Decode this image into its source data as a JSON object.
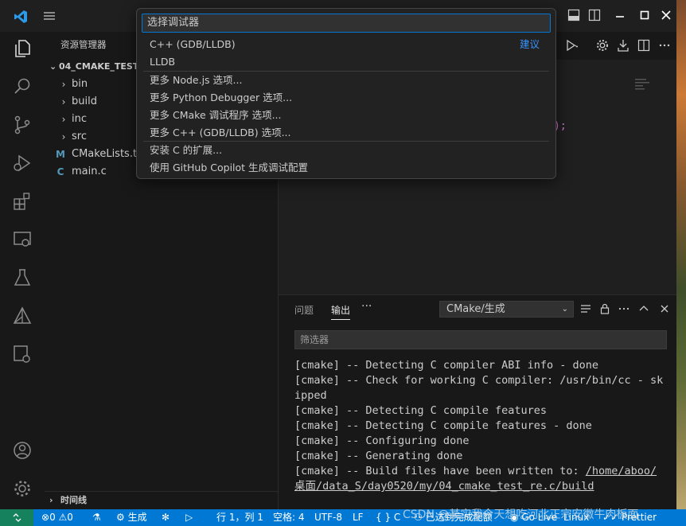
{
  "explorer": {
    "title": "资源管理器",
    "project": "04_CMAKE_TEST_",
    "items": [
      {
        "icon": "chevron-right",
        "label": "bin"
      },
      {
        "icon": "chevron-right",
        "label": "build"
      },
      {
        "icon": "chevron-right",
        "label": "inc"
      },
      {
        "icon": "chevron-right",
        "label": "src"
      },
      {
        "icon": "M",
        "label": "CMakeLists.txt"
      },
      {
        "icon": "C",
        "label": "main.c"
      }
    ],
    "timeline": "时间线"
  },
  "quickpick": {
    "placeholder": "选择调试器",
    "items": [
      {
        "label": "C++ (GDB/LLDB)",
        "badge": "建议"
      },
      {
        "label": "LLDB"
      },
      {
        "label": "更多 Node.js 选项..."
      },
      {
        "label": "更多 Python Debugger 选项..."
      },
      {
        "label": "更多 CMake 调试程序 选项..."
      },
      {
        "label": "更多 C++ (GDB/LLDB) 选项..."
      },
      {
        "label": "安装 C 的扩展..."
      },
      {
        "label": "使用 GitHub Copilot 生成调试配置"
      }
    ]
  },
  "editor": {
    "code_fragment": ");"
  },
  "panel": {
    "tabs": [
      "问题",
      "输出"
    ],
    "more": "···",
    "channel": "CMake/生成",
    "filter_placeholder": "筛选器",
    "output_lines": [
      "[cmake] -- Detecting C compiler ABI info - done",
      "[cmake] -- Check for working C compiler: /usr/bin/cc - skipped",
      "[cmake] -- Detecting C compile features",
      "[cmake] -- Detecting C compile features - done",
      "[cmake] -- Configuring done",
      "[cmake] -- Generating done"
    ],
    "last_line_prefix": "[cmake] -- Build files have been written to: ",
    "last_line_link": "/home/aboo/桌面/data_S/day0520/my/04_cmake_test_re.c/build"
  },
  "statusbar": {
    "errors": "0",
    "warnings": "0",
    "build": "生成",
    "position": "行 1，列 1",
    "spaces": "空格: 4",
    "encoding": "UTF-8",
    "eol": "LF",
    "language": "{ } C",
    "notice": "已达到完成配额",
    "golive": "Go Live",
    "os": "Linux",
    "prettier": "Prettier"
  },
  "watermark": "CSDN @某实我今天想吃河北正宗安徽牛肉板面",
  "colors": {
    "accent": "#0078d4",
    "status_bar": "#0078d4",
    "remote": "#16825d",
    "link": "#3794ff"
  }
}
